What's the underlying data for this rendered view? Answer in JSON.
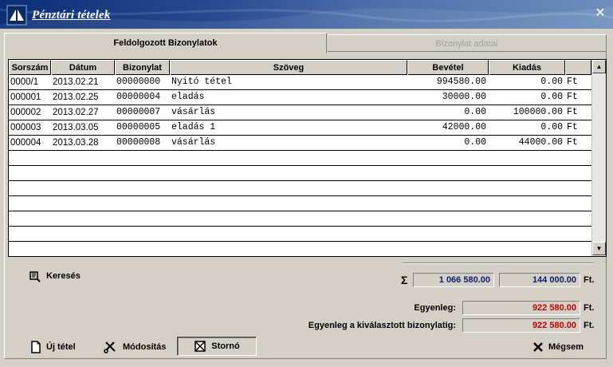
{
  "window": {
    "title": "Pénztári tételek"
  },
  "tabs": [
    {
      "label": "Feldolgozott Bizonylatok",
      "active": true
    },
    {
      "label": "Bizonylat adatai",
      "active": false
    }
  ],
  "table": {
    "columns": [
      "Sorszám",
      "Dátum",
      "Bizonylat",
      "Szöveg",
      "Bevétel",
      "Kiadás",
      ""
    ],
    "rows": [
      {
        "sorszam": "0000/1",
        "datum": "2013.02.21",
        "bizonylat": "00000000",
        "szoveg": "Nyitó tétel",
        "bevetel": "994580.00",
        "kiadas": "0.00",
        "unit": "Ft"
      },
      {
        "sorszam": "000001",
        "datum": "2013.02.25",
        "bizonylat": "00000004",
        "szoveg": "eladás",
        "bevetel": "30000.00",
        "kiadas": "0.00",
        "unit": "Ft"
      },
      {
        "sorszam": "000002",
        "datum": "2013.02.27",
        "bizonylat": "00000007",
        "szoveg": "vásárlás",
        "bevetel": "0.00",
        "kiadas": "100000.00",
        "unit": "Ft"
      },
      {
        "sorszam": "000003",
        "datum": "2013.03.05",
        "bizonylat": "00000005",
        "szoveg": "eladás 1",
        "bevetel": "42000.00",
        "kiadas": "0.00",
        "unit": "Ft"
      },
      {
        "sorszam": "000004",
        "datum": "2013.03.28",
        "bizonylat": "00000008",
        "szoveg": "vásárlás",
        "bevetel": "0.00",
        "kiadas": "44000.00",
        "unit": "Ft"
      }
    ]
  },
  "buttons": {
    "search": "Keresés",
    "new": "Új tétel",
    "modify": "Módosítás",
    "storno": "Stornó",
    "cancel": "Mégsem"
  },
  "summary": {
    "sigma": "Σ",
    "total_income": "1 066 580.00",
    "total_expense": "144 000.00",
    "unit": "Ft.",
    "balance_label": "Egyenleg:",
    "balance": "922 580.00",
    "balance_selected_label": "Egyenleg a kiválasztott bizonylatig:",
    "balance_selected": "922 580.00"
  },
  "colors": {
    "title_bar": "#0b2e78",
    "balance_text": "#c00000",
    "sum_text": "#0a1f6e"
  },
  "icons": [
    "logo-icon",
    "close-icon",
    "search-icon",
    "new-document-icon",
    "tools-icon",
    "storno-icon",
    "cancel-x-icon",
    "scroll-up-icon",
    "scroll-down-icon"
  ]
}
